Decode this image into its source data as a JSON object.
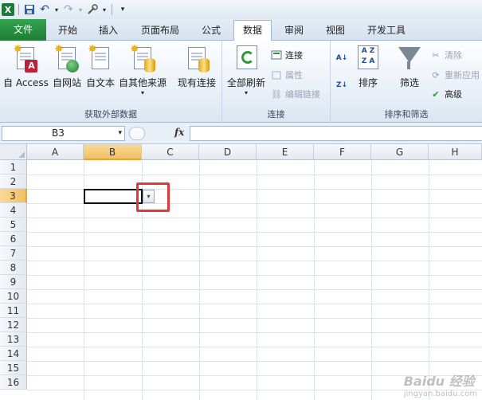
{
  "qat": {
    "undo": "↶",
    "redo": "↷",
    "logo": "X"
  },
  "tabs": [
    "文件",
    "开始",
    "插入",
    "页面布局",
    "公式",
    "数据",
    "审阅",
    "视图",
    "开发工具"
  ],
  "ribbon": {
    "groups": {
      "external": {
        "label": "获取外部数据",
        "buttons": [
          "自 Access",
          "自网站",
          "自文本",
          "自其他来源"
        ],
        "existing": "现有连接"
      },
      "connections": {
        "label": "连接",
        "refresh_all": "全部刷新",
        "items": [
          "连接",
          "属性",
          "编辑链接"
        ]
      },
      "sort_filter": {
        "label": "排序和筛选",
        "sort": "排序",
        "filter": "筛选",
        "items": [
          "清除",
          "重新应用",
          "高级"
        ]
      }
    }
  },
  "formula_bar": {
    "name_box": "B3",
    "fx": "fx",
    "value": ""
  },
  "grid": {
    "columns": [
      "A",
      "B",
      "C",
      "D",
      "E",
      "F",
      "G",
      "H"
    ],
    "rows": [
      "1",
      "2",
      "3",
      "4",
      "5",
      "6",
      "7",
      "8",
      "9",
      "10",
      "11",
      "12",
      "13",
      "14",
      "15",
      "16"
    ],
    "selected_column": "B",
    "selected_row": "3",
    "dropdown_glyph": "▾"
  },
  "watermark": {
    "brand": "Baidu 经验",
    "url": "jingyan.baidu.com"
  }
}
